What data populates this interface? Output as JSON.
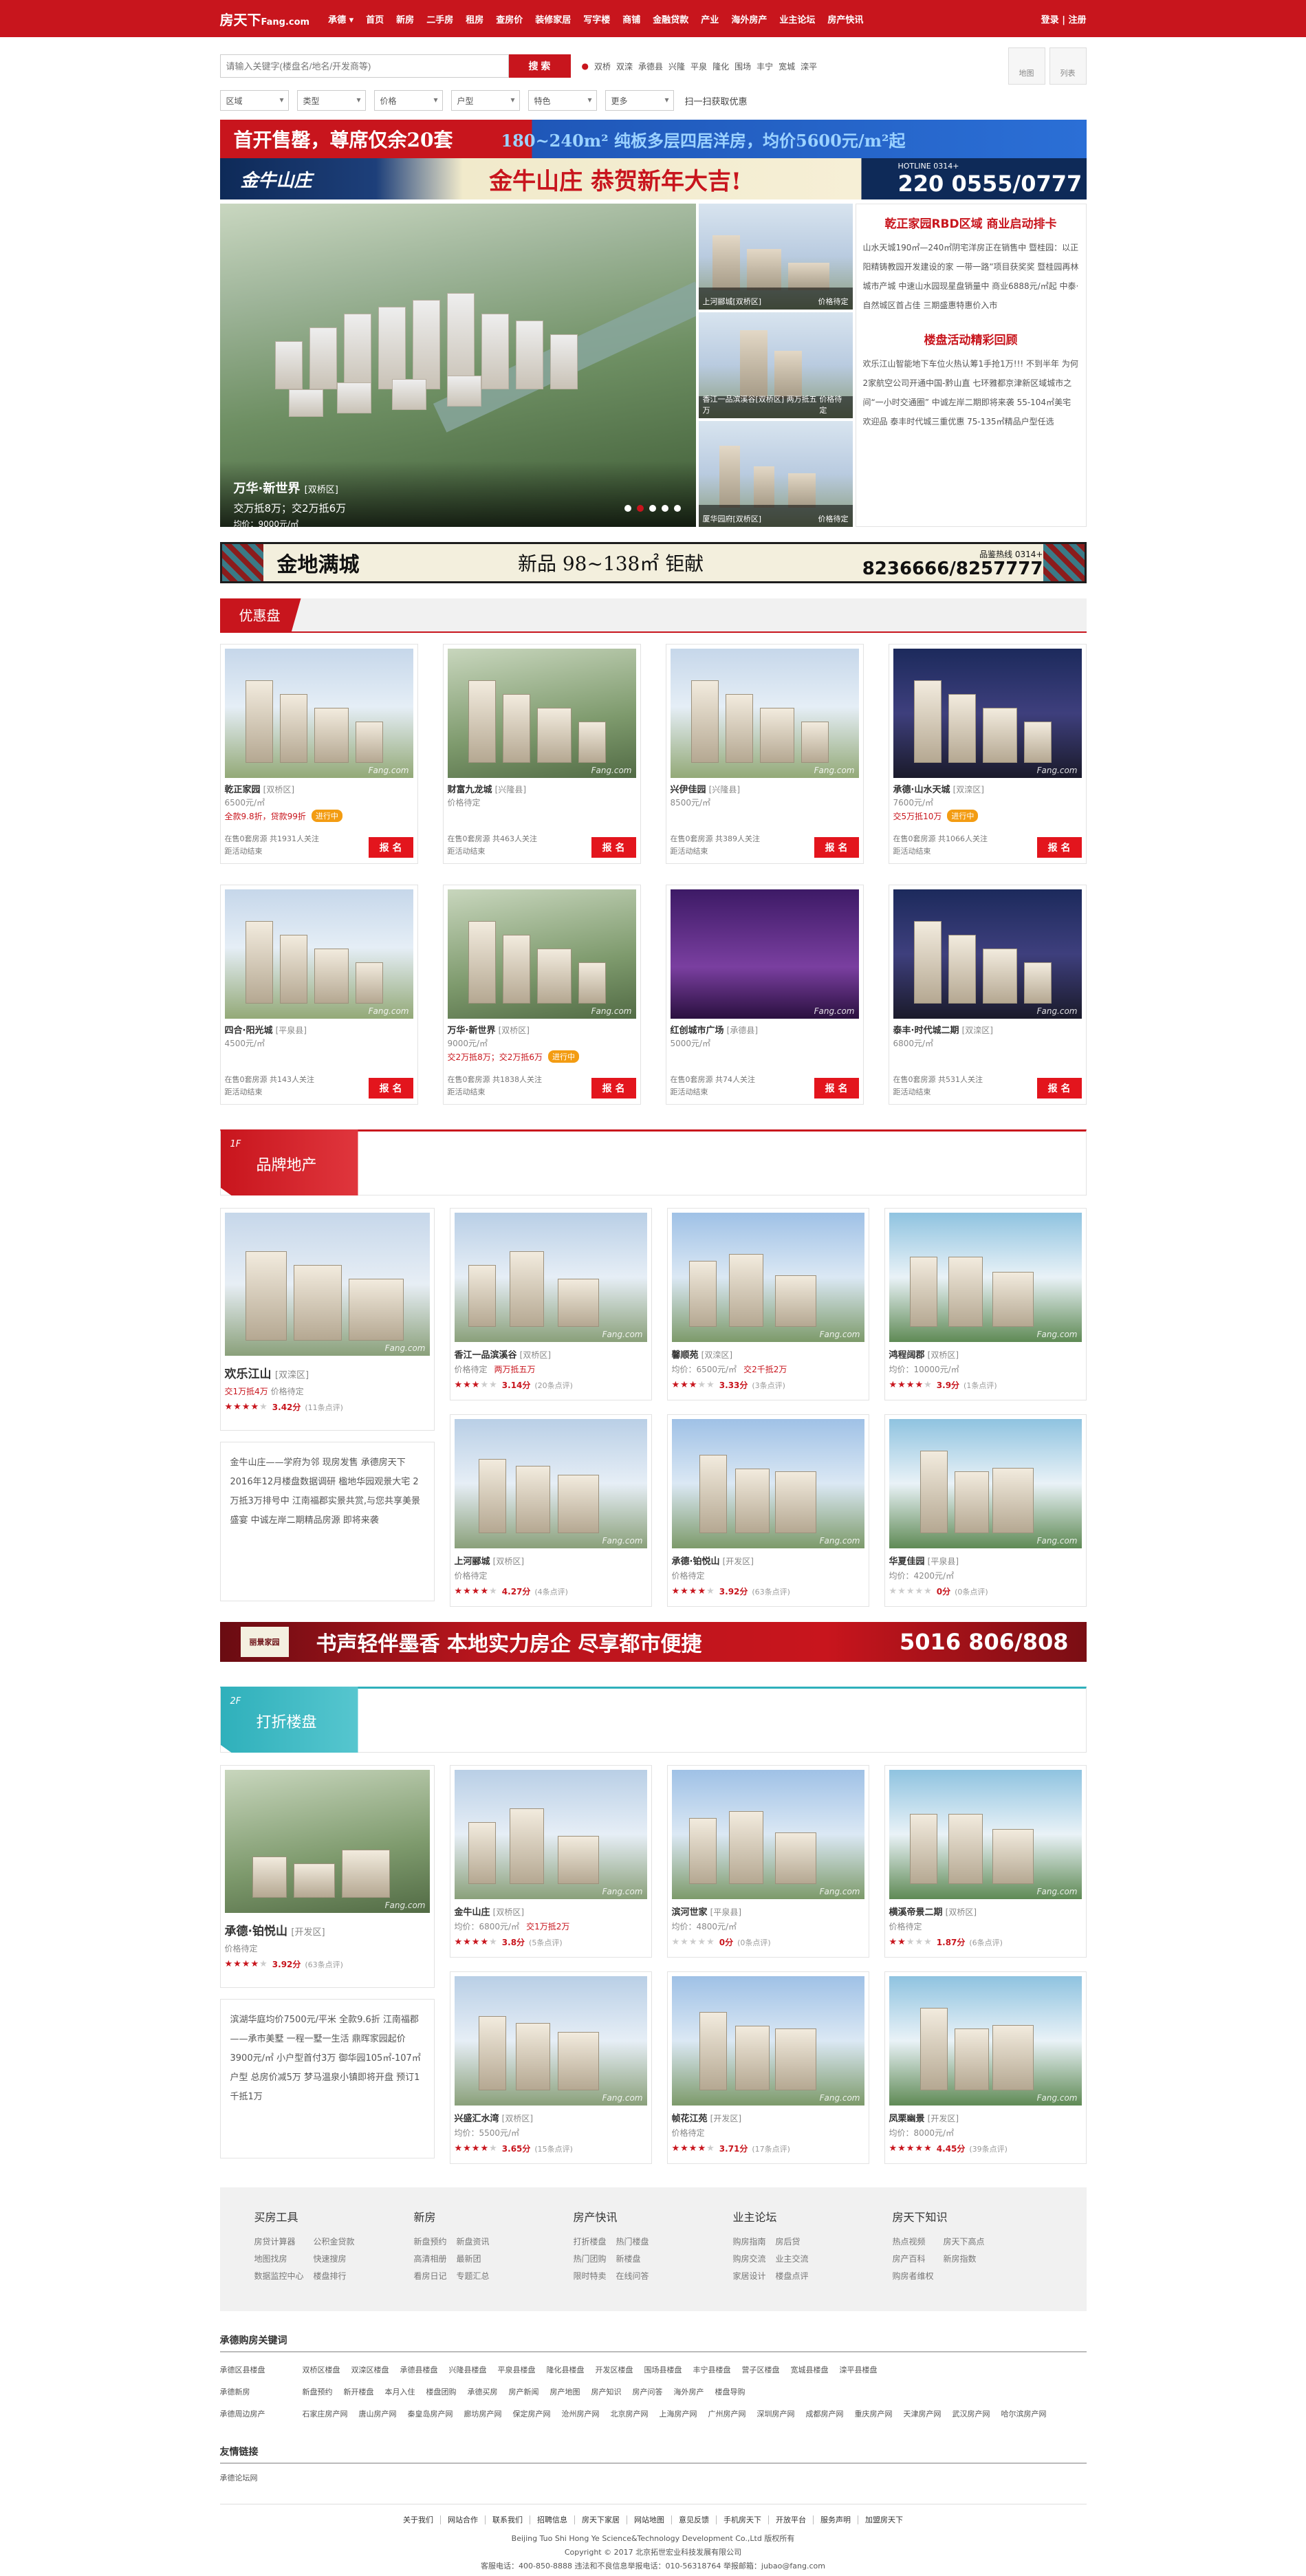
{
  "nav": {
    "logo_main": "房天下",
    "logo_sub": "Fang.com",
    "city": "承德",
    "items": [
      "首页",
      "新房",
      "二手房",
      "租房",
      "查房价",
      "装修家居",
      "写字楼",
      "商铺",
      "金融贷款",
      "产业",
      "海外房产",
      "业主论坛",
      "房产快讯"
    ],
    "login": "登录",
    "sep": "|",
    "register": "注册"
  },
  "search": {
    "placeholder": "请输入关键字(楼盘名/地名/开发商等)",
    "button": "搜 索",
    "areas": [
      "双桥",
      "双滦",
      "承德县",
      "兴隆",
      "平泉",
      "隆化",
      "围场",
      "丰宁",
      "宽城",
      "滦平"
    ],
    "view_map": "地图",
    "view_list": "列表"
  },
  "filters": {
    "items": [
      "区域",
      "类型",
      "价格",
      "户型",
      "特色",
      "更多"
    ],
    "hint": "扫一扫获取优惠"
  },
  "banner1": {
    "left": "首开售罄，尊席仅余20套",
    "right": "180~240m² 纯板多层四居洋房，均价5600元/m²起"
  },
  "banner2": {
    "logo": "金牛山庄",
    "title": "金牛山庄 恭贺新年大吉!",
    "hotline_label": "HOTLINE 0314+",
    "hotline": "220 0555/0777"
  },
  "hero": {
    "main": {
      "name": "万华·新世界",
      "district": "[双桥区]",
      "promo": "交万抵8万；交2万抵6万",
      "price": "均价：9000元/㎡"
    },
    "side": [
      {
        "name": "上河郦城[双桥区]",
        "price": "价格待定"
      },
      {
        "name": "香江一品滨溪谷[双桥区] 两万抵五万",
        "price": "价格待定"
      },
      {
        "name": "厦华园府[双桥区]",
        "price": "价格待定"
      }
    ],
    "news": [
      {
        "title": "乾正家园RBD区域 商业启动排卡",
        "text": "山水天城190㎡—240㎡阴宅洋房正在销售中 暨桂园：以正阳精铸教园开发建设的家 一带一路”项目获奖奖 暨桂园再林城市产城 中速山水园现星盘销量中 商业6888元/㎡起 中泰·自然城区首占佳 三期盛惠特惠价入市"
      },
      {
        "title": "楼盘活动精彩回顾",
        "text": "欢乐江山智能地下车位火热认筹1手抢1万!!! 不到半年 为何2家航空公司开通中国-黔山直 七环雅都京津新区域城市之间“一小时交通圈” 中诚左岸二期即将来袭 55-104㎡美宅欢迎品 泰丰时代城三重优惠 75-135㎡精品户型任选"
      }
    ]
  },
  "banner3": {
    "a": "金地满城",
    "b": "新品 98~138㎡ 钜献",
    "hot_label": "品鉴热线 0314+",
    "hot": "8236666/8257777"
  },
  "youhui": {
    "title": "优惠盘",
    "cards": [
      {
        "name": "乾正家园",
        "district": "[双桥区]",
        "price": "6500元/㎡",
        "discount": "全款9.8折，贷款99折",
        "tag": "进行中",
        "status": "在售",
        "meta1": "在售0套房源  共1931人关注",
        "meta2": "距活动结束",
        "btn": "报 名"
      },
      {
        "name": "财富九龙城",
        "district": "[兴隆县]",
        "price": "价格待定",
        "discount": "",
        "tag": "",
        "meta1": "在售0套房源  共463人关注",
        "meta2": "距活动结束",
        "btn": "报 名"
      },
      {
        "name": "兴伊佳园",
        "district": "[兴隆县]",
        "price": "8500元/㎡",
        "discount": "",
        "tag": "",
        "meta1": "在售0套房源  共389人关注",
        "meta2": "距活动结束",
        "btn": "报 名"
      },
      {
        "name": "承德·山水天城",
        "district": "[双滦区]",
        "price": "7600元/㎡",
        "discount": "交5万抵10万",
        "tag": "进行中",
        "meta1": "在售0套房源  共1066人关注",
        "meta2": "距活动结束",
        "btn": "报 名"
      },
      {
        "name": "四合·阳光城",
        "district": "[平泉县]",
        "price": "4500元/㎡",
        "discount": "",
        "tag": "",
        "meta1": "在售0套房源  共143人关注",
        "meta2": "距活动结束",
        "btn": "报 名"
      },
      {
        "name": "万华·新世界",
        "district": "[双桥区]",
        "price": "9000元/㎡",
        "discount": "交2万抵8万；交2万抵6万",
        "tag": "进行中",
        "meta1": "在售0套房源  共1838人关注",
        "meta2": "距活动结束",
        "btn": "报 名"
      },
      {
        "name": "红创城市广场",
        "district": "[承德县]",
        "price": "5000元/㎡",
        "discount": "",
        "tag": "",
        "meta1": "在售0套房源  共74人关注",
        "meta2": "距活动结束",
        "btn": "报 名"
      },
      {
        "name": "泰丰·时代城二期",
        "district": "[双滦区]",
        "price": "6800元/㎡",
        "discount": "",
        "tag": "",
        "meta1": "在售0套房源  共531人关注",
        "meta2": "距活动结束",
        "btn": "报 名"
      }
    ]
  },
  "floor1": {
    "num": "1F",
    "title": "品牌地产",
    "big": {
      "name": "欢乐江山",
      "district": "[双滦区]",
      "discount": "交1万抵4万",
      "price": "价格待定",
      "score": "3.42分",
      "count": "(11条点评)",
      "stars": 3.5
    },
    "text": "金牛山庄——学府为邻 现房发售 承德房天下2016年12月楼盘数据调研 楹地华园观景大宅 2万抵3万排号中 江南福郡实景共赏,与您共享美景盛宴 中诚左岸二期精品房源 即将来袭",
    "cards": [
      {
        "name": "香江一品滨溪谷",
        "district": "[双桥区]",
        "price": "价格待定",
        "promo": "两万抵五万",
        "score": "3.14分",
        "count": "(20条点评)",
        "stars": 3
      },
      {
        "name": "馨顺苑",
        "district": "[双滦区]",
        "price": "均价：6500元/㎡",
        "promo": "交2千抵2万",
        "score": "3.33分",
        "count": "(3条点评)",
        "stars": 3
      },
      {
        "name": "鸿程阔郡",
        "district": "[双桥区]",
        "price": "均价：10000元/㎡",
        "promo": "",
        "score": "3.9分",
        "count": "(1条点评)",
        "stars": 4
      },
      {
        "name": "上河郦城",
        "district": "[双桥区]",
        "price": "价格待定",
        "promo": "",
        "score": "4.27分",
        "count": "(4条点评)",
        "stars": 4
      },
      {
        "name": "承德·铂悦山",
        "district": "[开发区]",
        "price": "价格待定",
        "promo": "",
        "score": "3.92分",
        "count": "(63条点评)",
        "stars": 4
      },
      {
        "name": "华夏佳园",
        "district": "[平泉县]",
        "price": "均价：4200元/㎡",
        "promo": "",
        "score": "0分",
        "count": "(0条点评)",
        "stars": 0
      }
    ]
  },
  "banner4": {
    "logo": "丽景家园",
    "text": "书声轻伴墨香 本地实力房企 尽享都市便捷",
    "phone": "5016 806/808"
  },
  "floor2": {
    "num": "2F",
    "title": "打折楼盘",
    "big": {
      "name": "承德·铂悦山",
      "district": "[开发区]",
      "price": "价格待定",
      "discount": "",
      "score": "3.92分",
      "count": "(63条点评)",
      "stars": 4
    },
    "text": "滨湖华庭均价7500元/平米 全款9.6折 江南福郡——承市美墅 一程一墅一生活 鼎晖家园起价3900元/㎡ 小户型首付3万 御华园105㎡-107㎡户型 总房价减5万 梦马温泉小镇即将开盘 预订1千抵1万",
    "cards": [
      {
        "name": "金牛山庄",
        "district": "[双桥区]",
        "price": "均价：6800元/㎡",
        "promo": "交1万抵2万",
        "score": "3.8分",
        "count": "(5条点评)",
        "stars": 4
      },
      {
        "name": "滨河世家",
        "district": "[平泉县]",
        "price": "均价：4800元/㎡",
        "promo": "",
        "score": "0分",
        "count": "(0条点评)",
        "stars": 0
      },
      {
        "name": "横溪帝景二期",
        "district": "[双桥区]",
        "price": "价格待定",
        "promo": "",
        "score": "1.87分",
        "count": "(6条点评)",
        "stars": 2
      },
      {
        "name": "兴盛汇水湾",
        "district": "[双桥区]",
        "price": "均价：5500元/㎡",
        "promo": "",
        "score": "3.65分",
        "count": "(15条点评)",
        "stars": 3.5
      },
      {
        "name": "帧花江苑",
        "district": "[开发区]",
        "price": "价格待定",
        "promo": "",
        "score": "3.71分",
        "count": "(17条点评)",
        "stars": 3.5
      },
      {
        "name": "凤栗幽景",
        "district": "[开发区]",
        "price": "均价：8000元/㎡",
        "promo": "",
        "score": "4.45分",
        "count": "(39条点评)",
        "stars": 4.5
      }
    ]
  },
  "tools": [
    {
      "title": "买房工具",
      "links": [
        "房贷计算器",
        "公积金贷款",
        "地图找房",
        "快速搜房",
        "数据监控中心",
        "楼盘排行"
      ]
    },
    {
      "title": "新房",
      "links": [
        "新盘预约",
        "新盘资讯",
        "高清相册",
        "最新团",
        "看房日记",
        "专题汇总"
      ]
    },
    {
      "title": "房产快讯",
      "links": [
        "打折楼盘",
        "热门楼盘",
        "热门团购",
        "新楼盘",
        "限时特卖",
        "在线问答"
      ]
    },
    {
      "title": "业主论坛",
      "links": [
        "购房指南",
        "房后贷",
        "购房交流",
        "业主交流",
        "家居设计",
        "楼盘点评"
      ]
    },
    {
      "title": "房天下知识",
      "links": [
        "热点视频",
        "房天下高点",
        "房产百科",
        "新房指数",
        "购房者维权"
      ]
    }
  ],
  "keywords": {
    "title": "承德购房关键词",
    "rows": [
      {
        "k": "承德区县楼盘",
        "v": [
          "双桥区楼盘",
          "双滦区楼盘",
          "承德县楼盘",
          "兴隆县楼盘",
          "平泉县楼盘",
          "隆化县楼盘",
          "开发区楼盘",
          "围场县楼盘",
          "丰宁县楼盘",
          "营子区楼盘",
          "宽城县楼盘",
          "滦平县楼盘"
        ]
      },
      {
        "k": "承德新房",
        "v": [
          "新盘预约",
          "新开楼盘",
          "本月入住",
          "楼盘团购",
          "承德买房",
          "房产新闻",
          "房产地图",
          "房产知识",
          "房产问答",
          "海外房产",
          "楼盘导购"
        ]
      },
      {
        "k": "承德周边房产",
        "v": [
          "石家庄房产网",
          "唐山房产网",
          "秦皇岛房产网",
          "廊坊房产网",
          "保定房产网",
          "沧州房产网",
          "北京房产网",
          "上海房产网",
          "广州房产网",
          "深圳房产网",
          "成都房产网",
          "重庆房产网",
          "天津房产网",
          "武汉房产网",
          "哈尔滨房产网"
        ]
      }
    ]
  },
  "friend": {
    "title": "友情链接",
    "links": "承德论坛网"
  },
  "bottom": {
    "links": [
      "关于我们",
      "网站合作",
      "联系我们",
      "招聘信息",
      "房天下家居",
      "网站地图",
      "意见反馈",
      "手机房天下",
      "开放平台",
      "服务声明",
      "加盟房天下"
    ],
    "company": "Beijing Tuo Shi Hong Ye Science&Technology Development Co.,Ltd 版权所有",
    "copyright": "Copyright © 2017 北京拓世宏业科技发展有限公司",
    "service": "客服电话：400-850-8888   违法和不良信息举报电话：010-56318764   举报邮箱：jubao@fang.com"
  }
}
